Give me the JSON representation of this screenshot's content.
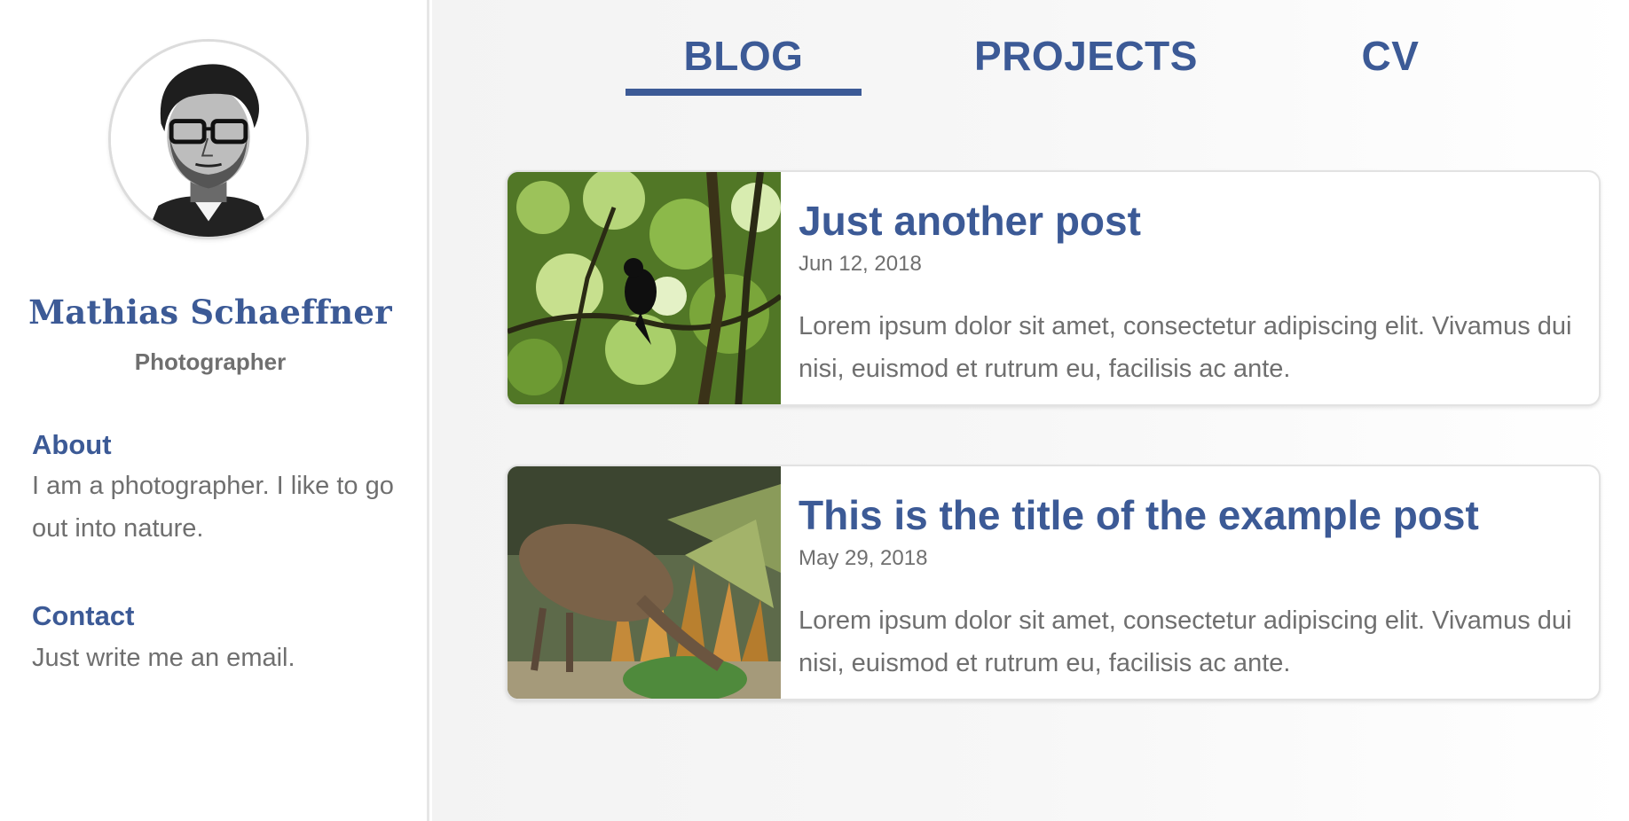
{
  "sidebar": {
    "name": "Mathias Schaeffner",
    "role": "Photographer",
    "about": {
      "title": "About",
      "text": "I am a photographer. I like to go out into nature."
    },
    "contact": {
      "title": "Contact",
      "text": "Just write me an email."
    },
    "avatar_icon": "portrait-sketch"
  },
  "nav": {
    "tabs": [
      {
        "label": "BLOG",
        "active": true
      },
      {
        "label": "PROJECTS",
        "active": false
      },
      {
        "label": "CV",
        "active": false
      }
    ]
  },
  "posts": [
    {
      "title": "Just another post",
      "date": "Jun 12, 2018",
      "excerpt": "Lorem ipsum dolor sit amet, consectetur adipiscing elit. Vivamus dui nisi, euismod et rutrum eu, facilisis ac ante.",
      "thumbnail": "forest-bird-photo"
    },
    {
      "title": "This is the title of the example post",
      "date": "May 29, 2018",
      "excerpt": "Lorem ipsum dolor sit amet, consectetur adipiscing elit. Vivamus dui nisi, euismod et rutrum eu, facilisis ac ante.",
      "thumbnail": "kiwi-bird-diorama-photo"
    }
  ],
  "colors": {
    "accent": "#3c5a96",
    "text_muted": "#6f6f6f",
    "border": "#e2e2e2"
  }
}
